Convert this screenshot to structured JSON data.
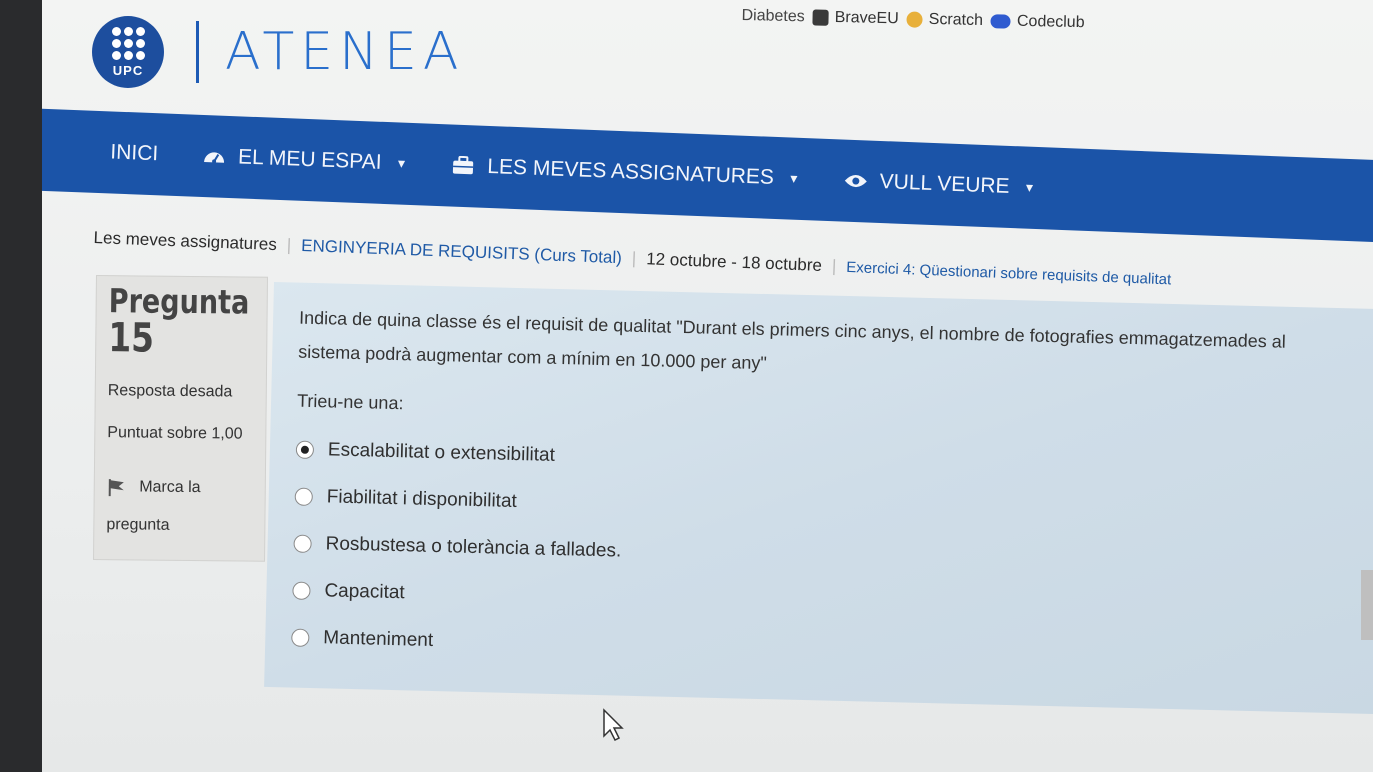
{
  "bookmarks": [
    {
      "label": "Diabetes",
      "icon": "partial-bookmark-icon",
      "color": "#3b6fc4"
    },
    {
      "label": "BraveEU",
      "icon": "brave-icon",
      "color": "#3a3a3a"
    },
    {
      "label": "Scratch",
      "icon": "scratch-icon",
      "color": "#e8b03a"
    },
    {
      "label": "Codeclub",
      "icon": "codeclub-icon",
      "color": "#2f5bd0"
    }
  ],
  "header": {
    "logo_text": "UPC",
    "site_name": "ATENEA"
  },
  "nav": {
    "items": [
      {
        "label": "INICI",
        "icon": "",
        "dropdown": false
      },
      {
        "label": "EL MEU ESPAI",
        "icon": "dashboard-icon",
        "dropdown": true
      },
      {
        "label": "LES MEVES ASSIGNATURES",
        "icon": "briefcase-icon",
        "dropdown": true
      },
      {
        "label": "VULL VEURE",
        "icon": "eye-icon",
        "dropdown": true
      }
    ]
  },
  "breadcrumb": [
    "Les meves assignatures",
    "ENGINYERIA DE REQUISITS (Curs Total)",
    "12 octubre - 18 octubre",
    "Exercici 4: Qüestionari sobre requisits de qualitat"
  ],
  "info": {
    "question_label": "Pregunta",
    "question_number": "15",
    "status": "Resposta desada",
    "score": "Puntuat sobre 1,00",
    "flag_label": "Marca la pregunta"
  },
  "question": {
    "text": "Indica de quina classe és el requisit de qualitat \"Durant els primers cinc anys, el nombre de fotografies emmagatzemades al sistema podrà augmentar com a mínim en 10.000 per any\"",
    "prompt": "Trieu-ne una:",
    "options": [
      {
        "label": "Escalabilitat o extensibilitat",
        "selected": true
      },
      {
        "label": "Fiabilitat i disponibilitat",
        "selected": false
      },
      {
        "label": "Rosbustesa o tolerància a fallades.",
        "selected": false
      },
      {
        "label": "Capacitat",
        "selected": false
      },
      {
        "label": "Manteniment",
        "selected": false
      }
    ]
  },
  "colors": {
    "nav_bg": "#1b54a8",
    "link": "#1f5aa6",
    "question_bg": "#d3e0ea",
    "info_bg": "#e3e3e1"
  }
}
